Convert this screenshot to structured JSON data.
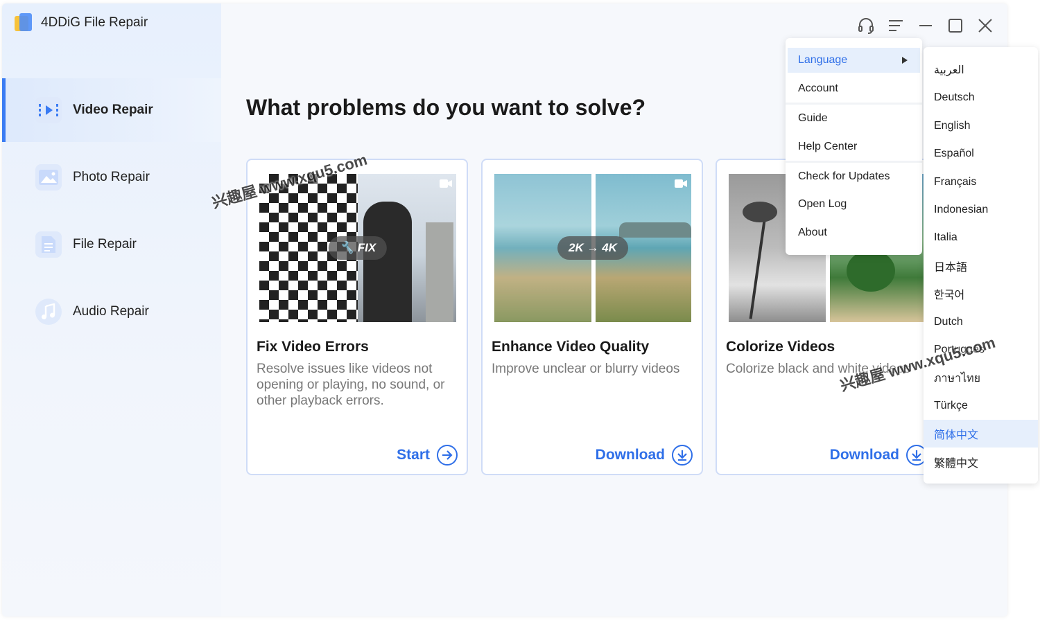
{
  "app": {
    "title": "4DDiG File Repair"
  },
  "sidebar": {
    "items": [
      {
        "label": "Video Repair",
        "icon": "video-repair-icon",
        "active": true
      },
      {
        "label": "Photo Repair",
        "icon": "photo-repair-icon",
        "active": false
      },
      {
        "label": "File Repair",
        "icon": "file-repair-icon",
        "active": false
      },
      {
        "label": "Audio Repair",
        "icon": "audio-repair-icon",
        "active": false
      }
    ]
  },
  "main": {
    "headline": "What problems do you want to solve?",
    "cards": [
      {
        "title": "Fix Video Errors",
        "description": "Resolve issues like videos not opening or playing, no sound, or other playback errors.",
        "action": "Start",
        "badge": "FIX"
      },
      {
        "title": "Enhance Video Quality",
        "description": "Improve unclear or blurry videos",
        "action": "Download",
        "badge": "2K → 4K"
      },
      {
        "title": "Colorize Videos",
        "description": "Colorize black and white videos",
        "action": "Download",
        "badge": ""
      }
    ]
  },
  "menu": {
    "items": [
      "Language",
      "Account",
      "Guide",
      "Help Center",
      "Check for Updates",
      "Open Log",
      "About"
    ]
  },
  "languages": {
    "items": [
      "العربية",
      "Deutsch",
      "English",
      "Español",
      "Français",
      "Indonesian",
      "Italia",
      "日本語",
      "한국어",
      "Dutch",
      "Português",
      "ภาษาไทย",
      "Türkçe",
      "简体中文",
      "繁體中文"
    ],
    "selected": "简体中文"
  },
  "watermark": {
    "text": "兴趣屋 www.xqu5.com"
  },
  "colors": {
    "accent": "#2f6fe8",
    "active_bar": "#3a7bf3",
    "card_border": "#cfdcf7"
  }
}
